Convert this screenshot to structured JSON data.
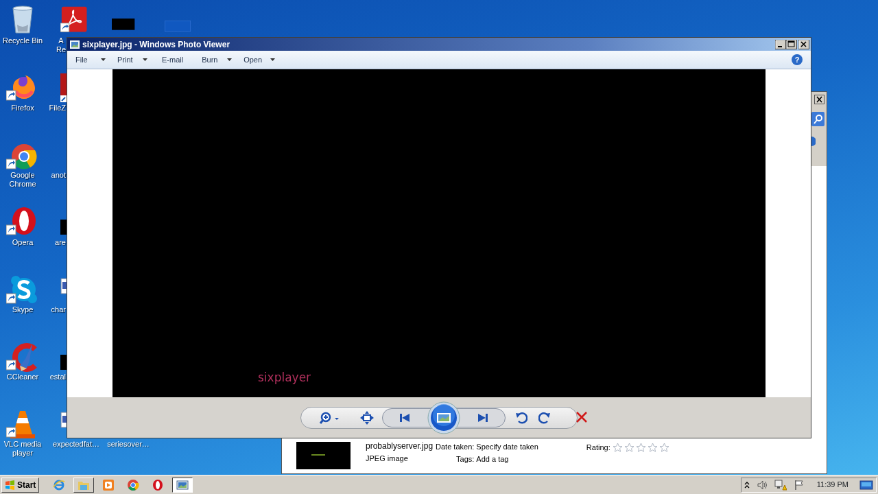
{
  "desktop": {
    "icons": [
      {
        "label": "Recycle Bin",
        "kind": "recycle",
        "shortcut": false
      },
      {
        "label": "Firefox",
        "kind": "firefox",
        "shortcut": true
      },
      {
        "label": "Google Chrome",
        "kind": "chrome",
        "shortcut": true
      },
      {
        "label": "Opera",
        "kind": "opera",
        "shortcut": true
      },
      {
        "label": "Skype",
        "kind": "skype",
        "shortcut": true
      },
      {
        "label": "CCleaner",
        "kind": "ccleaner",
        "shortcut": true
      },
      {
        "label": "VLC media player",
        "kind": "vlc",
        "shortcut": true
      },
      {
        "label": "A Re",
        "kind": "pdf",
        "shortcut": true
      },
      {
        "label": "FileZ",
        "kind": "app",
        "shortcut": true
      },
      {
        "label": "anot",
        "kind": "none"
      },
      {
        "label": "are",
        "kind": "dark",
        "shortcut": false
      },
      {
        "label": "char",
        "kind": "doc",
        "shortcut": false
      },
      {
        "label": "estal",
        "kind": "dark",
        "shortcut": false
      },
      {
        "label": "expectedfat…",
        "kind": "doc",
        "shortcut": false
      },
      {
        "label": "seriesover…",
        "kind": "none"
      },
      {
        "kind": "dark"
      },
      {
        "kind": "bluefile"
      }
    ]
  },
  "back_window": {
    "details": {
      "file_name": "probablyserver.jpg",
      "file_type": "JPEG image",
      "date_label": "Date taken:",
      "date_value": "Specify date taken",
      "tags_label": "Tags:",
      "tags_value": "Add a tag",
      "rating_label": "Rating:",
      "stars": 0
    }
  },
  "window": {
    "title": "sixplayer.jpg - Windows Photo Viewer",
    "menu": [
      {
        "label": "File",
        "dropdown": true
      },
      {
        "label": "Print",
        "dropdown": true
      },
      {
        "label": "E-mail",
        "dropdown": false
      },
      {
        "label": "Burn",
        "dropdown": true
      },
      {
        "label": "Open",
        "dropdown": true
      }
    ],
    "help": "?",
    "image": {
      "caption": "sixplayer"
    },
    "controls": [
      {
        "kind": "zoom"
      },
      {
        "kind": "fit"
      },
      {
        "kind": "previous"
      },
      {
        "kind": "slideshow"
      },
      {
        "kind": "next"
      },
      {
        "kind": "rotate-left"
      },
      {
        "kind": "rotate-right"
      },
      {
        "kind": "delete"
      }
    ]
  },
  "taskbar": {
    "start": "Start",
    "items": [
      {
        "kind": "ie",
        "running": false,
        "active": false
      },
      {
        "kind": "explorer",
        "running": true,
        "active": false
      },
      {
        "kind": "media",
        "running": false,
        "active": false
      },
      {
        "kind": "chrome",
        "running": false,
        "active": false
      },
      {
        "kind": "opera",
        "running": false,
        "active": false
      },
      {
        "kind": "photos",
        "running": true,
        "active": true
      }
    ],
    "clock": "11:39 PM"
  }
}
